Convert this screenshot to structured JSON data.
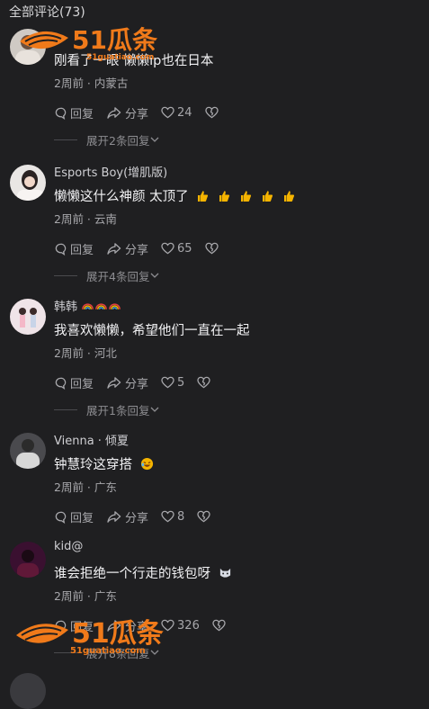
{
  "header": {
    "title": "全部评论(73)"
  },
  "comments": [
    {
      "name": "",
      "text": "刚看了一眼 懒懒ip也在日本",
      "meta": "2周前 · 内蒙古",
      "reply_label": "回复",
      "share_label": "分享",
      "likes": "24",
      "expand": "展开2条回复"
    },
    {
      "name": "Esports Boy(增肌版)",
      "text": "懒懒这什么神颜  太顶了",
      "meta": "2周前 · 云南",
      "reply_label": "回复",
      "share_label": "分享",
      "likes": "65",
      "expand": "展开4条回复"
    },
    {
      "name": "韩韩",
      "text": "我喜欢懒懒，希望他们一直在一起",
      "meta": "2周前 · 河北",
      "reply_label": "回复",
      "share_label": "分享",
      "likes": "5",
      "expand": "展开1条回复"
    },
    {
      "name": "Vienna · 倾夏",
      "text": "钟慧玲这穿搭",
      "meta": "2周前 · 广东",
      "reply_label": "回复",
      "share_label": "分享",
      "likes": "8",
      "expand": ""
    },
    {
      "name": "kid@",
      "text": "谁会拒绝一个行走的钱包呀",
      "meta": "2周前 · 广东",
      "reply_label": "回复",
      "share_label": "分享",
      "likes": "326",
      "expand": "展开8条回复"
    }
  ],
  "watermark": {
    "brand": "51瓜条",
    "url": "51guatiao.com"
  },
  "colors": {
    "background": "#1f1f21",
    "watermark": "#f07a1a",
    "emoji": "#f5b400"
  }
}
